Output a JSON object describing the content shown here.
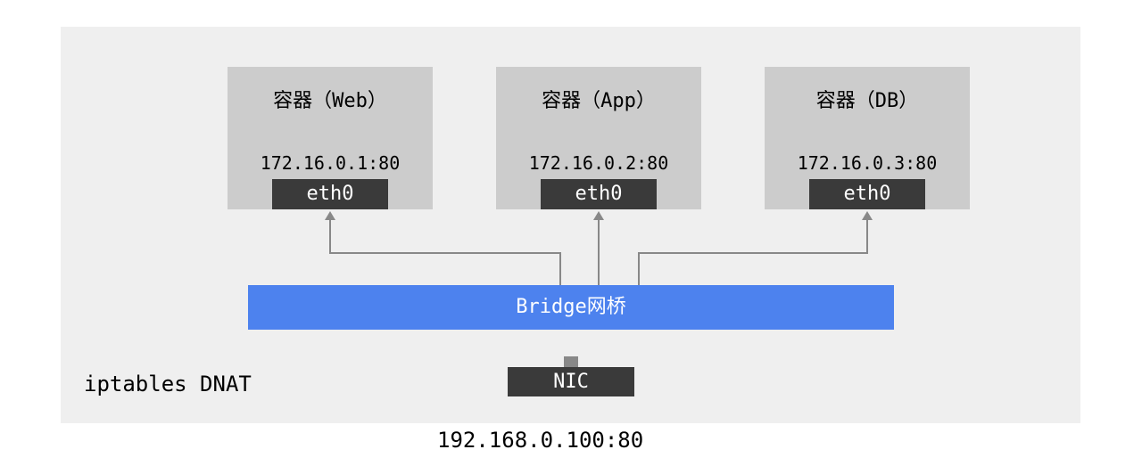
{
  "containers": [
    {
      "title": "容器（Web）",
      "ip": "172.16.0.1:80",
      "iface": "eth0"
    },
    {
      "title": "容器（App）",
      "ip": "172.16.0.2:80",
      "iface": "eth0"
    },
    {
      "title": "容器（DB）",
      "ip": "172.16.0.3:80",
      "iface": "eth0"
    }
  ],
  "bridge": {
    "label": "Bridge网桥"
  },
  "nic": {
    "label": "NIC",
    "ip": "192.168.0.100:80"
  },
  "corner_label": "iptables DNAT"
}
